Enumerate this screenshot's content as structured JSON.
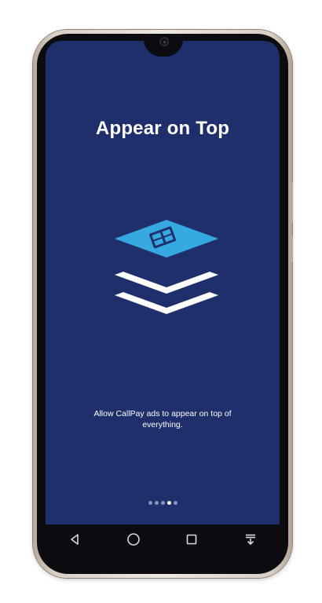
{
  "onboarding": {
    "title": "Appear on Top",
    "illustration_icon": "stacked-layers-icon",
    "description": "Allow CallPay ads to appear on top of everything.",
    "pager": {
      "total_pages": 5,
      "current_page": 4
    }
  },
  "navigation_bar": {
    "back_icon": "back-triangle-icon",
    "home_icon": "home-circle-icon",
    "recents_icon": "recents-square-icon",
    "notifications_icon": "pull-down-notifications-icon"
  },
  "colors": {
    "screen_background": "#1f2f6b",
    "accent_layer": "#36a9e1",
    "layer_white": "#ffffff",
    "inactive_dot": "#8d93b4"
  }
}
